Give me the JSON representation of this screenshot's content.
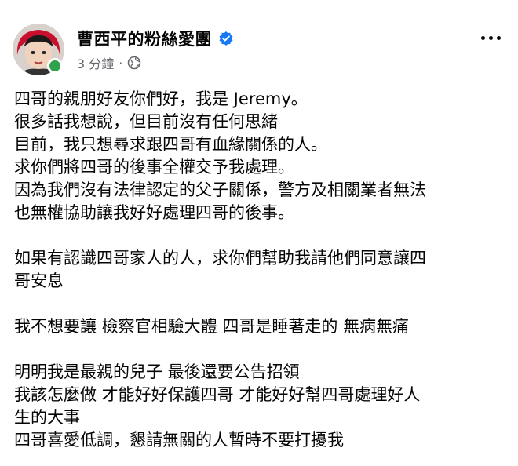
{
  "post": {
    "page_name": "曹西平的粉絲愛團",
    "timestamp": "3 分鐘",
    "separator": "·",
    "privacy_icon": "globe-icon",
    "verified_icon": "verified-badge-icon",
    "more_icon": "more-options-icon",
    "paragraphs": [
      [
        "四哥的親朋好友你們好，我是 Jeremy。",
        "很多話我想說，但目前沒有任何思緒",
        "目前，我只想尋求跟四哥有血緣關係的人。",
        "求你們將四哥的後事全權交予我處理。",
        "因為我們沒有法律認定的父子關係，警方及相關業者無法",
        "也無權協助讓我好好處理四哥的後事。"
      ],
      [
        "如果有認識四哥家人的人，求你們幫助我請他們同意讓四",
        "哥安息"
      ],
      [
        "我不想要讓 檢察官相驗大體 四哥是睡著走的 無病無痛"
      ],
      [
        "明明我是最親的兒子 最後還要公告招領",
        "我該怎麼做 才能好好保護四哥 才能好好幫四哥處理好人",
        "生的大事",
        "四哥喜愛低調，懇請無關的人暫時不要打擾我"
      ]
    ]
  },
  "colors": {
    "verified": "#1877f2",
    "online": "#31a24c",
    "meta_text": "#65676b",
    "text": "#050505"
  }
}
